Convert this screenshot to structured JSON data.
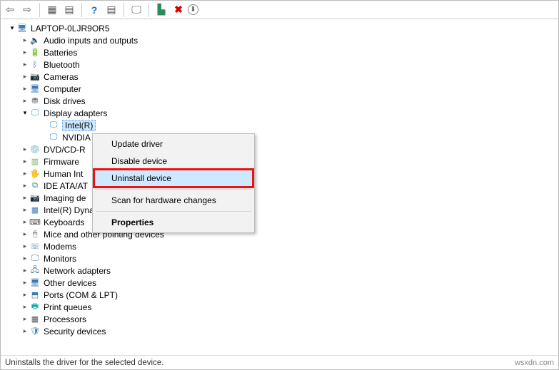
{
  "toolbar": {
    "back": "⇦",
    "forward": "⇨",
    "show_hidden": "▦",
    "properties": "▤",
    "help": "?",
    "devices": "▤",
    "scan": "🖵",
    "update": "▙",
    "uninstall": "✖",
    "action": "⬇"
  },
  "root": {
    "label": "LAPTOP-0LJR9OR5"
  },
  "categories": [
    {
      "label": "Audio inputs and outputs",
      "open": false,
      "icon": "🔈",
      "cls": "ico-audio"
    },
    {
      "label": "Batteries",
      "open": false,
      "icon": "🔋",
      "cls": "ico-batt"
    },
    {
      "label": "Bluetooth",
      "open": false,
      "icon": "ᛒ",
      "cls": "ico-bt"
    },
    {
      "label": "Cameras",
      "open": false,
      "icon": "📷",
      "cls": "ico-cam"
    },
    {
      "label": "Computer",
      "open": false,
      "icon": "🖥",
      "cls": "ico-pc"
    },
    {
      "label": "Disk drives",
      "open": false,
      "icon": "⛃",
      "cls": "ico-disk"
    },
    {
      "label": "Display adapters",
      "open": true,
      "icon": "🖵",
      "cls": "ico-disp",
      "children": [
        {
          "label": "Intel(R)",
          "selected": true
        },
        {
          "label": "NVIDIA",
          "selected": false
        }
      ]
    },
    {
      "label": "DVD/CD-R",
      "open": false,
      "icon": "💿",
      "cls": "ico-dvd"
    },
    {
      "label": "Firmware",
      "open": false,
      "icon": "▥",
      "cls": "ico-fw"
    },
    {
      "label": "Human Int",
      "open": false,
      "icon": "🖐",
      "cls": "ico-hid"
    },
    {
      "label": "IDE ATA/AT",
      "open": false,
      "icon": "⧉",
      "cls": "ico-ide"
    },
    {
      "label": "Imaging de",
      "open": false,
      "icon": "📷",
      "cls": "ico-img"
    },
    {
      "label": "Intel(R) Dynamic Platform and Thermal Framework",
      "open": false,
      "icon": "▦",
      "cls": "ico-pc"
    },
    {
      "label": "Keyboards",
      "open": false,
      "icon": "⌨",
      "cls": "ico-kb"
    },
    {
      "label": "Mice and other pointing devices",
      "open": false,
      "icon": "🖱",
      "cls": "ico-mouse"
    },
    {
      "label": "Modems",
      "open": false,
      "icon": "☏",
      "cls": "ico-modem"
    },
    {
      "label": "Monitors",
      "open": false,
      "icon": "🖵",
      "cls": "ico-mon"
    },
    {
      "label": "Network adapters",
      "open": false,
      "icon": "🖧",
      "cls": "ico-net"
    },
    {
      "label": "Other devices",
      "open": false,
      "icon": "🖥",
      "cls": "ico-other"
    },
    {
      "label": "Ports (COM & LPT)",
      "open": false,
      "icon": "⬒",
      "cls": "ico-port"
    },
    {
      "label": "Print queues",
      "open": false,
      "icon": "🖶",
      "cls": "ico-print"
    },
    {
      "label": "Processors",
      "open": false,
      "icon": "▦",
      "cls": "ico-proc"
    },
    {
      "label": "Security devices",
      "open": false,
      "icon": "🛡",
      "cls": "ico-sec"
    }
  ],
  "context_menu": {
    "update_driver": "Update driver",
    "disable_device": "Disable device",
    "uninstall_device": "Uninstall device",
    "scan": "Scan for hardware changes",
    "properties": "Properties"
  },
  "status_text": "Uninstalls the driver for the selected device.",
  "watermark": "wsxdn.com"
}
